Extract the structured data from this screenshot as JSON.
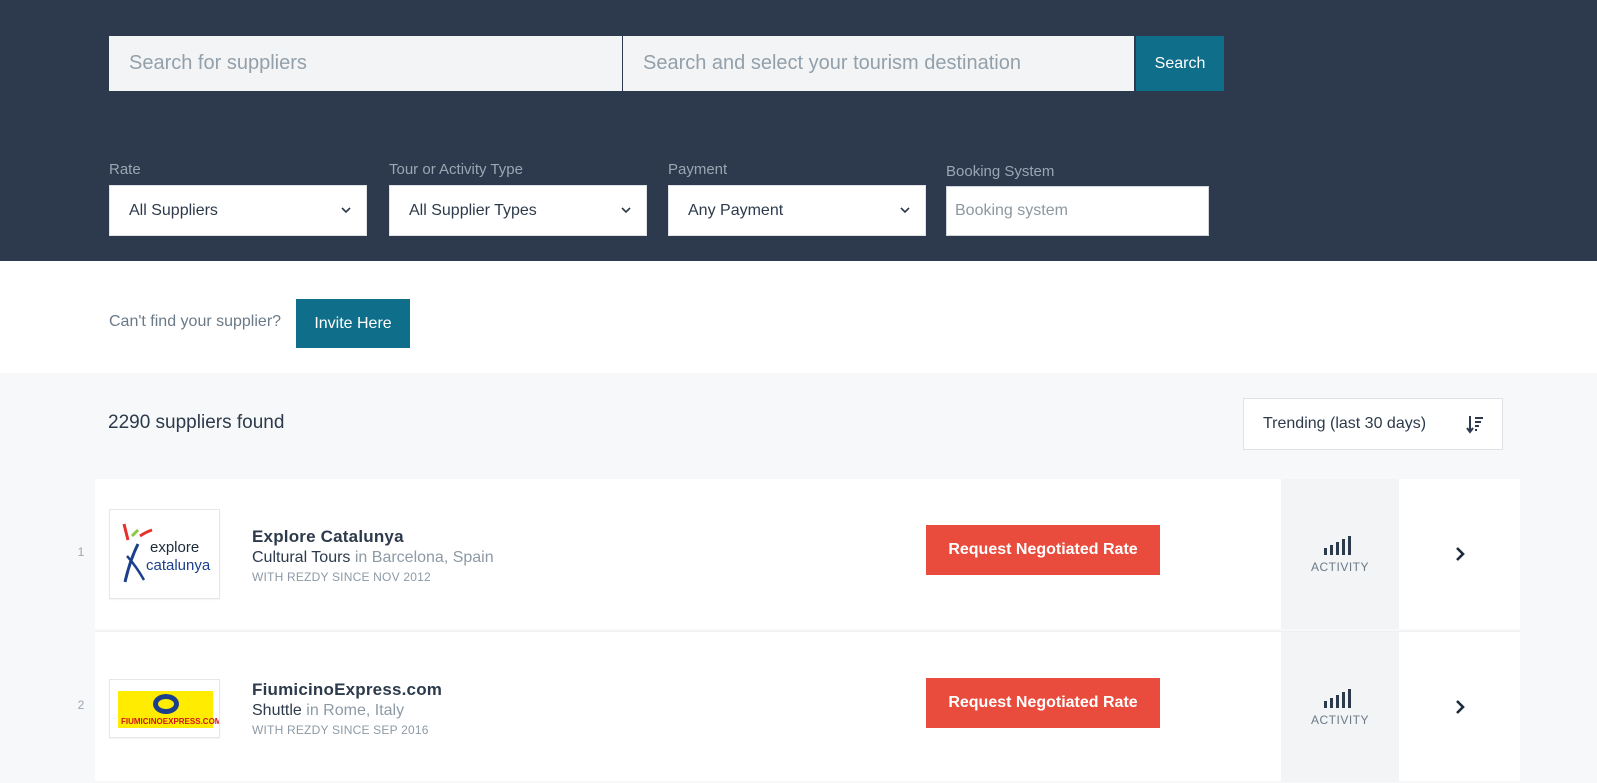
{
  "search": {
    "supplier_placeholder": "Search for suppliers",
    "destination_placeholder": "Search and select your tourism destination",
    "button_label": "Search"
  },
  "filters": {
    "rate": {
      "label": "Rate",
      "value": "All Suppliers"
    },
    "type": {
      "label": "Tour or Activity Type",
      "value": "All Supplier Types"
    },
    "payment": {
      "label": "Payment",
      "value": "Any Payment"
    },
    "booking": {
      "label": "Booking System",
      "placeholder": "Booking system"
    }
  },
  "invite": {
    "prompt": "Can't find your supplier?",
    "button_label": "Invite Here"
  },
  "results": {
    "count_text": "2290 suppliers found",
    "sort_value": "Trending (last 30 days)",
    "items": [
      {
        "rank": "1",
        "name": "Explore Catalunya",
        "category": "Cultural Tours",
        "in_word": " in ",
        "location": "Barcelona, Spain",
        "since": "WITH REZDY SINCE NOV 2012",
        "cta": "Request Negotiated Rate",
        "activity_label": "ACTIVITY",
        "logo_text_1": "explore",
        "logo_text_2": "catalunya"
      },
      {
        "rank": "2",
        "name": "FiumicinoExpress.com",
        "category": "Shuttle",
        "in_word": " in ",
        "location": "Rome, Italy",
        "since": "WITH REZDY SINCE SEP 2016",
        "cta": "Request Negotiated Rate",
        "activity_label": "ACTIVITY",
        "logo_text": "FIUMICINOEXPRESS.COM"
      }
    ]
  },
  "colors": {
    "header_bg": "#2d3a4e",
    "primary_button": "#0f6e89",
    "cta_red": "#e94b3c",
    "results_bg": "#f7f8f9"
  }
}
